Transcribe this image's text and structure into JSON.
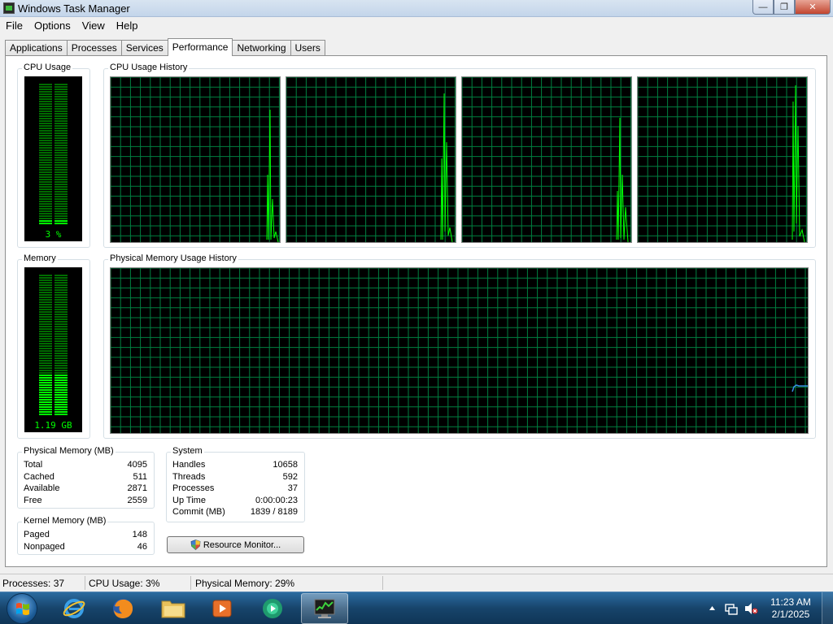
{
  "window": {
    "title": "Windows Task Manager",
    "buttons": {
      "minimize": "—",
      "maximize": "❐",
      "close": "✕"
    }
  },
  "menu": [
    "File",
    "Options",
    "View",
    "Help"
  ],
  "tabs": [
    {
      "label": "Applications",
      "active": false
    },
    {
      "label": "Processes",
      "active": false
    },
    {
      "label": "Services",
      "active": false
    },
    {
      "label": "Performance",
      "active": true
    },
    {
      "label": "Networking",
      "active": false
    },
    {
      "label": "Users",
      "active": false
    }
  ],
  "performance": {
    "cpu_usage": {
      "label": "CPU Usage",
      "value_text": "3 %",
      "percent": 3
    },
    "cpu_history": {
      "label": "CPU Usage History",
      "cores": 4
    },
    "memory": {
      "label": "Memory",
      "value_text": "1.19 GB",
      "percent": 29
    },
    "memory_history": {
      "label": "Physical Memory Usage History"
    },
    "physical_memory": {
      "label": "Physical Memory (MB)",
      "rows": [
        {
          "name": "Total",
          "value": "4095"
        },
        {
          "name": "Cached",
          "value": "511"
        },
        {
          "name": "Available",
          "value": "2871"
        },
        {
          "name": "Free",
          "value": "2559"
        }
      ]
    },
    "kernel_memory": {
      "label": "Kernel Memory (MB)",
      "rows": [
        {
          "name": "Paged",
          "value": "148"
        },
        {
          "name": "Nonpaged",
          "value": "46"
        }
      ]
    },
    "system": {
      "label": "System",
      "rows": [
        {
          "name": "Handles",
          "value": "10658"
        },
        {
          "name": "Threads",
          "value": "592"
        },
        {
          "name": "Processes",
          "value": "37"
        },
        {
          "name": "Up Time",
          "value": "0:00:00:23"
        },
        {
          "name": "Commit (MB)",
          "value": "1839 / 8189"
        }
      ]
    },
    "resource_monitor_button": "Resource Monitor..."
  },
  "status_bar": {
    "processes": "Processes: 37",
    "cpu": "CPU Usage: 3%",
    "memory": "Physical Memory: 29%"
  },
  "taskbar": {
    "apps": [
      "internet-explorer-icon",
      "firefox-icon",
      "file-explorer-icon",
      "media-player-icon",
      "media-center-icon",
      "task-manager-icon"
    ],
    "clock": {
      "time": "11:23 AM",
      "date": "2/1/2025"
    }
  },
  "colors": {
    "graph_grid": "#008040",
    "graph_line": "#00ff00",
    "memory_line": "#3a8ee6",
    "meter_lit": "#00ff00",
    "meter_dim": "#006b00"
  }
}
